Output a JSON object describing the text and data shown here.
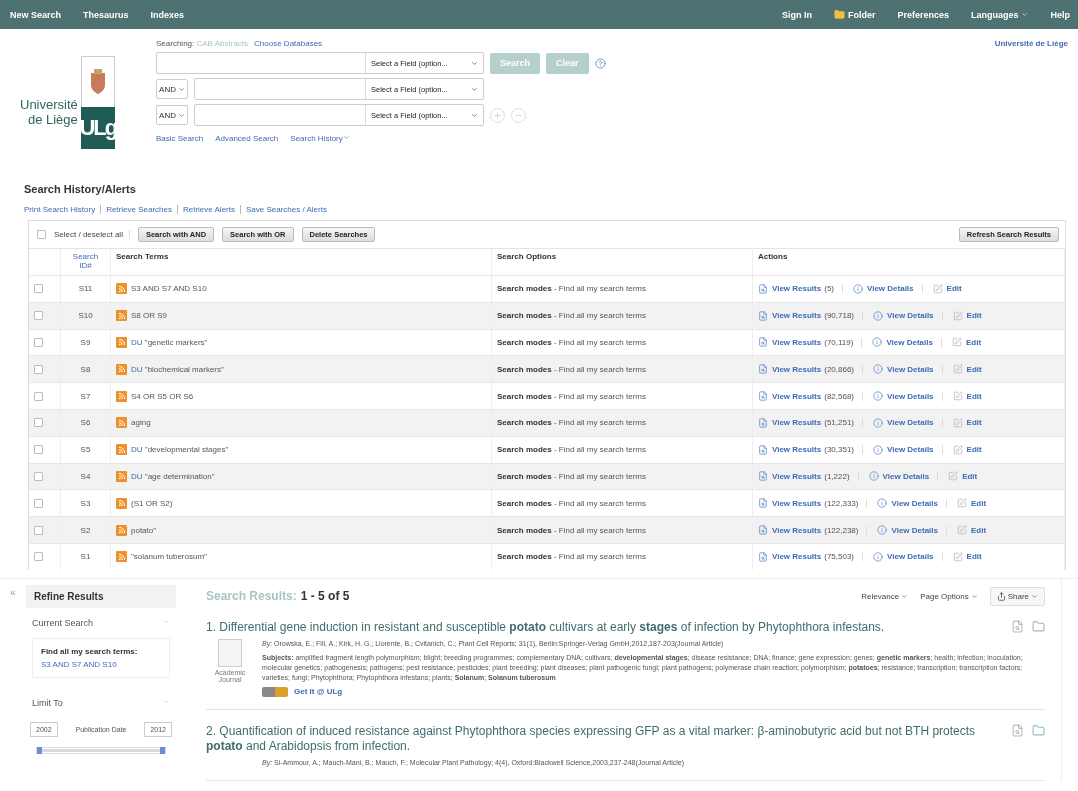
{
  "top_nav": {
    "left": [
      "New Search",
      "Thesaurus",
      "Indexes"
    ],
    "right": [
      {
        "label": "Sign In",
        "kind": "link"
      },
      {
        "label": "Folder",
        "kind": "folder"
      },
      {
        "label": "Preferences",
        "kind": "link"
      },
      {
        "label": "Languages",
        "kind": "menu"
      },
      {
        "label": "Help",
        "kind": "link"
      }
    ]
  },
  "logo": {
    "lines": [
      "Université",
      "de Liège"
    ],
    "mark": "ULg"
  },
  "searching": {
    "label": "Searching:",
    "database": "CAB Abstracts",
    "choose": "Choose Databases"
  },
  "query_rows": [
    {
      "operator": null,
      "field": "Select a Field (option..."
    },
    {
      "operator": "AND",
      "field": "Select a Field (option..."
    },
    {
      "operator": "AND",
      "field": "Select a Field (option..."
    }
  ],
  "search_button": "Search",
  "clear_button": "Clear",
  "search_links": [
    {
      "label": "Basic Search",
      "kind": "link"
    },
    {
      "label": "Advanced Search",
      "kind": "link"
    },
    {
      "label": "Search History",
      "kind": "menu"
    }
  ],
  "institution": "Université de Liège",
  "history": {
    "title": "Search History/Alerts",
    "links": [
      "Print Search History",
      "Retrieve Searches",
      "Retrieve Alerts",
      "Save Searches / Alerts"
    ],
    "select_all": {
      "label": "Select / deselect all",
      "checked": false
    },
    "buttons": [
      "Search with AND",
      "Search with OR",
      "Delete Searches"
    ],
    "refresh": "Refresh Search Results",
    "columns": [
      "Search ID#",
      "Search Terms",
      "Search Options",
      "Actions"
    ],
    "rows": [
      {
        "checked": false,
        "id": "S11",
        "field_code": null,
        "terms": "S3 AND S7 AND S10",
        "options_label": "Search modes",
        "options_text": "- Find all my search terms",
        "view_results": "View Results",
        "count": "(5)",
        "view_details": "View Details",
        "edit": "Edit"
      },
      {
        "checked": false,
        "id": "S10",
        "field_code": null,
        "terms": "S8 OR S9",
        "options_label": "Search modes",
        "options_text": "- Find all my search terms",
        "view_results": "View Results",
        "count": "(90,718)",
        "view_details": "View Details",
        "edit": "Edit"
      },
      {
        "checked": false,
        "id": "S9",
        "field_code": "DU",
        "terms": "\"genetic markers\"",
        "options_label": "Search modes",
        "options_text": "- Find all my search terms",
        "view_results": "View Results",
        "count": "(70,119)",
        "view_details": "View Details",
        "edit": "Edit"
      },
      {
        "checked": false,
        "id": "S8",
        "field_code": "DU",
        "terms": "\"biochemical markers\"",
        "options_label": "Search modes",
        "options_text": "- Find all my search terms",
        "view_results": "View Results",
        "count": "(20,866)",
        "view_details": "View Details",
        "edit": "Edit"
      },
      {
        "checked": false,
        "id": "S7",
        "field_code": null,
        "terms": "S4 OR S5 OR S6",
        "options_label": "Search modes",
        "options_text": "- Find all my search terms",
        "view_results": "View Results",
        "count": "(82,568)",
        "view_details": "View Details",
        "edit": "Edit"
      },
      {
        "checked": false,
        "id": "S6",
        "field_code": null,
        "terms": "aging",
        "options_label": "Search modes",
        "options_text": "- Find all my search terms",
        "view_results": "View Results",
        "count": "(51,251)",
        "view_details": "View Details",
        "edit": "Edit"
      },
      {
        "checked": false,
        "id": "S5",
        "field_code": "DU",
        "terms": "\"developmental stages\"",
        "options_label": "Search modes",
        "options_text": "- Find all my search terms",
        "view_results": "View Results",
        "count": "(30,351)",
        "view_details": "View Details",
        "edit": "Edit"
      },
      {
        "checked": false,
        "id": "S4",
        "field_code": "DU",
        "terms": "\"age determination\"",
        "options_label": "Search modes",
        "options_text": "- Find all my search terms",
        "view_results": "View Results",
        "count": "(1,222)",
        "view_details": "View Details",
        "edit": "Edit"
      },
      {
        "checked": false,
        "id": "S3",
        "field_code": null,
        "terms": "(S1 OR S2)",
        "options_label": "Search modes",
        "options_text": "- Find all my search terms",
        "view_results": "View Results",
        "count": "(122,333)",
        "view_details": "View Details",
        "edit": "Edit"
      },
      {
        "checked": false,
        "id": "S2",
        "field_code": null,
        "terms": "potato\"",
        "options_label": "Search modes",
        "options_text": "- Find all my search terms",
        "view_results": "View Results",
        "count": "(122,238)",
        "view_details": "View Details",
        "edit": "Edit"
      },
      {
        "checked": false,
        "id": "S1",
        "field_code": null,
        "terms": "\"solanum tuberosum\"",
        "options_label": "Search modes",
        "options_text": "- Find all my search terms",
        "view_results": "View Results",
        "count": "(75,503)",
        "view_details": "View Details",
        "edit": "Edit"
      }
    ]
  },
  "refine": {
    "collapse": "«",
    "title": "Refine Results",
    "current_search": "Current Search",
    "current_label": "Find all my search terms:",
    "current_query": "S3 AND S7 AND S10",
    "limit_to": "Limit To",
    "date_from": "2002",
    "date_label": "Publication Date",
    "date_to": "2012",
    "date_slider": {
      "level": 1
    }
  },
  "results": {
    "label": "Search Results:",
    "range": "1 - 5 of 5",
    "controls": [
      {
        "label": "Relevance",
        "kind": "menu"
      },
      {
        "label": "Page Options",
        "kind": "menu"
      },
      {
        "label": "Share",
        "kind": "share"
      }
    ],
    "items": [
      {
        "number": "1.",
        "title": "Differential gene induction in resistant and susceptible **potato** cultivars at early **stages** of infection by Phytophthora infestans.",
        "by": "*By:* Orowska, E.; Fill, A.; Kirk, H. G.; Llorente, B.; Cvitanich, C.;  Plant Cell Reports;  31(1),  Berlin:Springer-Verlag GmbH,2012,187-203(Journal Article)",
        "subjects": "**Subjects:** amplified fragment length polymorphism; blight; breeding programmes; complementary DNA; cultivars; **developmental stages**; disease resistance; DNA; finance; gene expression; genes; **genetic markers**; health; infection; inoculation; molecular genetics; pathogenesis; pathogens; pest resistance; pesticides; plant breeding; plant diseases; plant pathogenic fungi; plant pathogens; polymerase chain reaction; polymorphism; **potatoes**; resistance; transcription; transcription factors; varieties; fungi; Phytophthora; Phytophthora infestans; plants; **Solanum**; **Solanum tuberosum**",
        "type": "Academic Journal",
        "get_it": "Get It @ ULg"
      },
      {
        "number": "2.",
        "title": "Quantification of induced resistance against Phytophthora species expressing GFP as a vital marker: β-aminobutyric acid but not BTH protects **potato** and Arabidopsis from infection.",
        "by": "*By:* Si-Ammour, A.; Mauch-Mani, B.; Mauch, F.;  Molecular Plant Pathology;  4(4),  Oxford:Blackwell Science,2003,237-248(Journal Article)"
      }
    ]
  }
}
